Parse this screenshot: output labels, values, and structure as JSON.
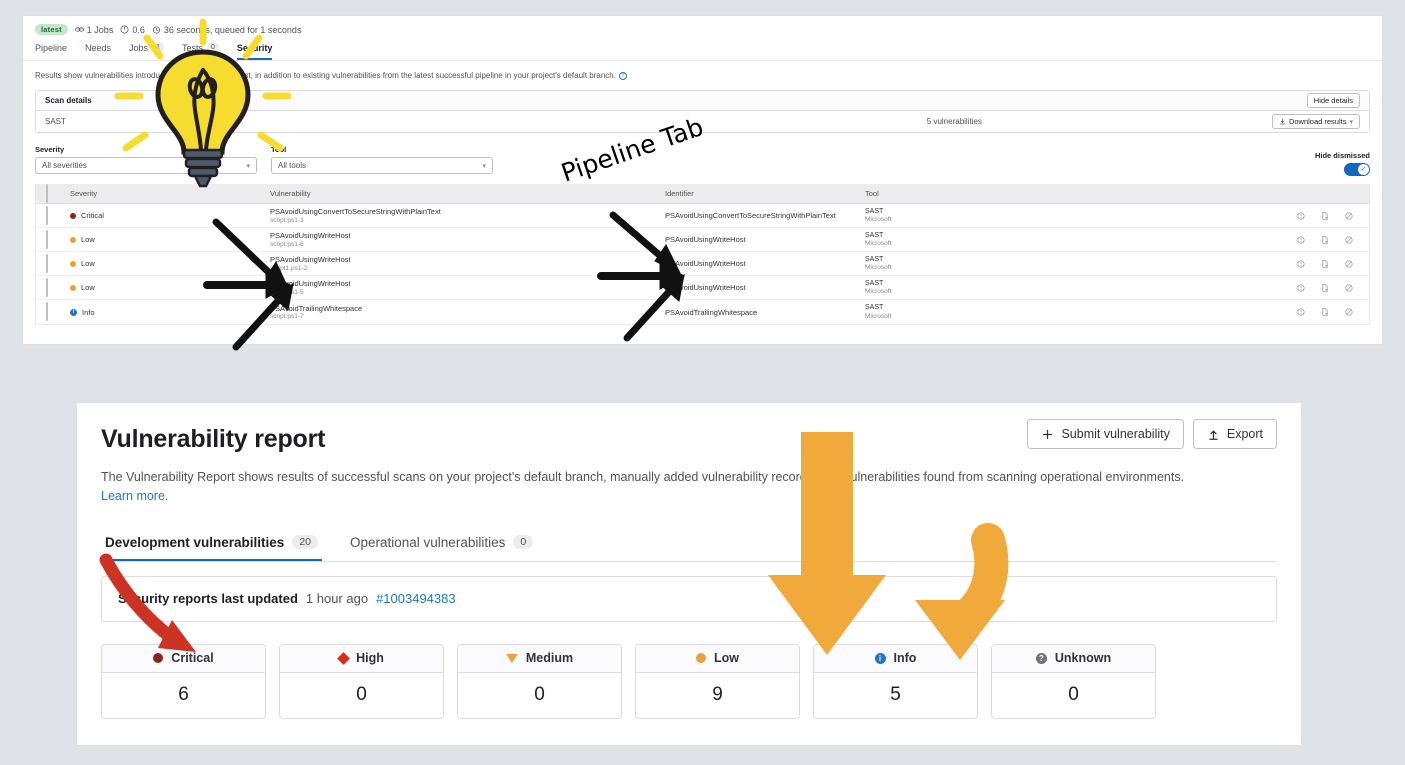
{
  "pipeline": {
    "badge": "latest",
    "jobs": "1 Jobs",
    "coverage": "0.6",
    "duration": "36 seconds, queued for 1 seconds",
    "tabs": [
      {
        "label": "Pipeline",
        "count": null
      },
      {
        "label": "Needs",
        "count": null
      },
      {
        "label": "Jobs",
        "count": "1"
      },
      {
        "label": "Tests",
        "count": "0"
      },
      {
        "label": "Security",
        "count": null
      }
    ],
    "intro": "Results show vulnerabilities introduced by the merge request, in addition to existing vulnerabilities from the latest successful pipeline in your project's default branch.",
    "scan_details": {
      "title": "Scan details",
      "hide_details_label": "Hide details",
      "scanner": "SAST",
      "count": "5 vulnerabilities",
      "download_label": "Download results"
    },
    "filters": {
      "severity_label": "Severity",
      "severity_value": "All severities",
      "tool_label": "Tool",
      "tool_value": "All tools",
      "hide_dismissed_label": "Hide dismissed",
      "hide_dismissed_on": true
    },
    "table": {
      "columns": [
        "Severity",
        "Vulnerability",
        "Identifier",
        "Tool"
      ],
      "rows": [
        {
          "severity": "Critical",
          "severity_color": "#8b2615",
          "vulnerability": "PSAvoidUsingConvertToSecureStringWithPlainText",
          "location": "script.ps1-3",
          "identifier": "PSAvoidUsingConvertToSecureStringWithPlainText",
          "tool": "SAST",
          "tool_vendor": "Microsoft"
        },
        {
          "severity": "Low",
          "severity_color": "#e9a13b",
          "vulnerability": "PSAvoidUsingWriteHost",
          "location": "script.ps1-6",
          "identifier": "PSAvoidUsingWriteHost",
          "tool": "SAST",
          "tool_vendor": "Microsoft"
        },
        {
          "severity": "Low",
          "severity_color": "#e9a13b",
          "vulnerability": "PSAvoidUsingWriteHost",
          "location": "script1.ps1-2",
          "identifier": "PSAvoidUsingWriteHost",
          "tool": "SAST",
          "tool_vendor": "Microsoft"
        },
        {
          "severity": "Low",
          "severity_color": "#e9a13b",
          "vulnerability": "PSAvoidUsingWriteHost",
          "location": "script.ps1-5",
          "identifier": "PSAvoidUsingWriteHost",
          "tool": "SAST",
          "tool_vendor": "Microsoft"
        },
        {
          "severity": "Info",
          "severity_color": "#1f75cb",
          "vulnerability": "PSAvoidTrailingWhitespace",
          "location": "script.ps1-7",
          "identifier": "PSAvoidTrailingWhitespace",
          "tool": "SAST",
          "tool_vendor": "Microsoft"
        }
      ]
    }
  },
  "report": {
    "title": "Vulnerability report",
    "submit_label": "Submit vulnerability",
    "export_label": "Export",
    "description": "The Vulnerability Report shows results of successful scans on your project's default branch, manually added vulnerability records, and vulnerabilities found from scanning operational environments.",
    "learn_more": "Learn more.",
    "tabs": [
      {
        "label": "Development vulnerabilities",
        "count": "20"
      },
      {
        "label": "Operational vulnerabilities",
        "count": "0"
      }
    ],
    "updated": {
      "label": "Security reports last updated",
      "time": "1 hour ago",
      "pipeline_id": "#1003494383"
    },
    "severity_cards": [
      {
        "label": "Critical",
        "value": "6",
        "color": "#8b2615",
        "icon": "critical-circle-icon"
      },
      {
        "label": "High",
        "value": "0",
        "color": "#dd2b0e",
        "icon": "high-diamond-icon"
      },
      {
        "label": "Medium",
        "value": "0",
        "color": "#e9a13b",
        "icon": "medium-triangle-icon"
      },
      {
        "label": "Low",
        "value": "9",
        "color": "#e9a13b",
        "icon": "low-circle-icon"
      },
      {
        "label": "Info",
        "value": "5",
        "color": "#1f75cb",
        "icon": "info-circle-icon"
      },
      {
        "label": "Unknown",
        "value": "0",
        "color": "#737278",
        "icon": "unknown-question-icon"
      }
    ]
  },
  "annotations": {
    "pipeline_tab_text": "Pipeline Tab",
    "arrow_color_black": "#111111",
    "arrow_color_red": "#cc3322",
    "arrow_color_orange": "#f2a93b",
    "bulb_color": "#f5dc2e"
  }
}
